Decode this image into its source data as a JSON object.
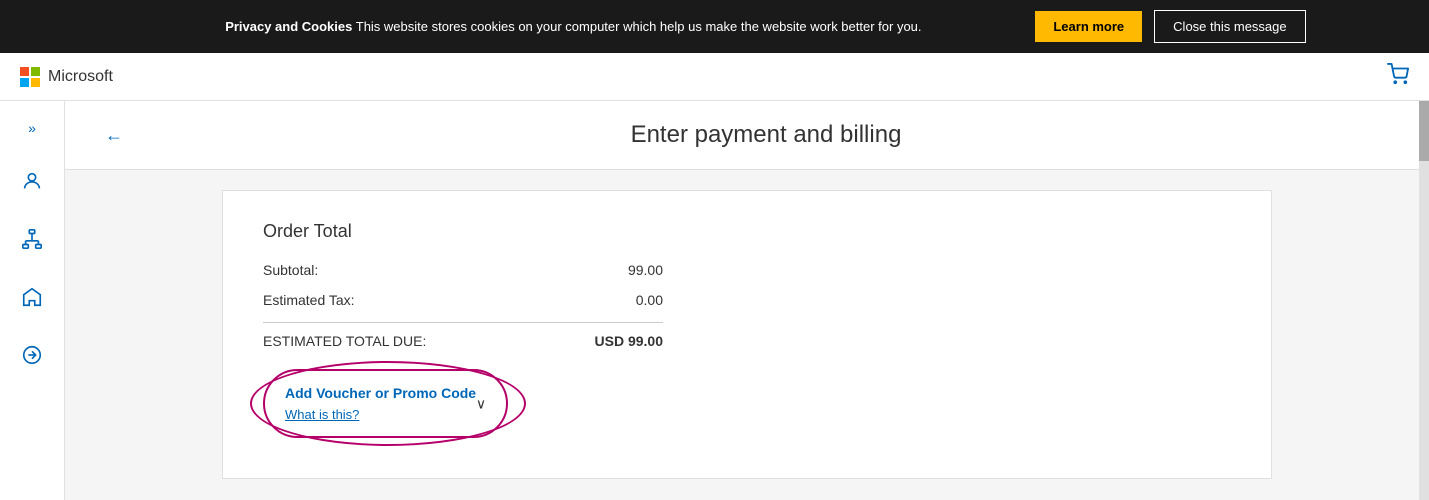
{
  "cookie_banner": {
    "bold_text": "Privacy and Cookies",
    "message": " This website stores cookies on your computer which help us make the website work better for you.",
    "learn_more_label": "Learn more",
    "close_label": "Close this message"
  },
  "top_nav": {
    "brand_name": "Microsoft",
    "cart_icon": "🛒"
  },
  "sidebar": {
    "expand_icon": "»",
    "icons": [
      "person",
      "network",
      "home",
      "arrow-right"
    ]
  },
  "page": {
    "back_icon": "←",
    "title": "Enter payment and billing"
  },
  "order": {
    "heading": "Order Total",
    "subtotal_label": "Subtotal:",
    "subtotal_value": "99.00",
    "tax_label": "Estimated Tax:",
    "tax_value": "0.00",
    "total_label": "ESTIMATED TOTAL DUE:",
    "total_value": "USD 99.00",
    "promo_link_label": "Add Voucher or Promo Code",
    "promo_sub_label": "What is this?",
    "chevron": "∨"
  },
  "colors": {
    "microsoft_blue": "#0067b8",
    "promo_oval": "#b5006a",
    "learn_more_bg": "#ffb900"
  }
}
